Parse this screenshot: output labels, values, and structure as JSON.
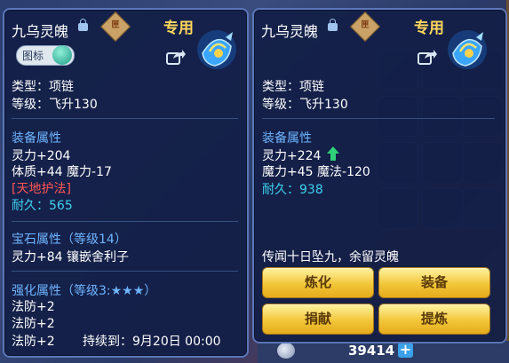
{
  "background": {
    "gold_amount": "39414",
    "add_label": "+"
  },
  "left_panel": {
    "item_name": "九乌灵魄",
    "seal_char": "匣",
    "exclusive_label": "专用",
    "icon_toggle_label": "图标",
    "type_line": "类型：项链",
    "level_line": "等级：飞升130",
    "equip_attr_header": "装备属性",
    "attr_lines": [
      "灵力+204",
      "体质+44 魔力-17"
    ],
    "special_line": "[天地护法]",
    "durability_line": "耐久：565",
    "gem_header": "宝石属性（等级14）",
    "gem_line": "灵力+84 镶嵌舍利子",
    "enhance_header": "强化属性（等级3:★★★）",
    "enhance_lines": [
      "法防+2",
      "法防+2",
      "法防+2"
    ],
    "duration_text": "持续到：9月20日 00:00"
  },
  "right_panel": {
    "item_name": "九乌灵魄",
    "seal_char": "匣",
    "exclusive_label": "专用",
    "type_line": "类型：项链",
    "level_line": "等级：飞升130",
    "equip_attr_header": "装备属性",
    "attr_line_1": "灵力+224",
    "attr_line_2": "魔力+45 魔法-120",
    "durability_line": "耐久：938",
    "description": "传闻十日坠九，余留灵魄",
    "buttons": {
      "refine": "炼化",
      "equip": "装备",
      "donate": "捐献",
      "extract": "提炼"
    }
  },
  "colors": {
    "section_blue": "#6fb4ff",
    "durability_cyan": "#3fd2f0",
    "special_red": "#ff5656",
    "exclusive_gold": "#ffd75a",
    "up_arrow_green": "#2fd07a"
  }
}
